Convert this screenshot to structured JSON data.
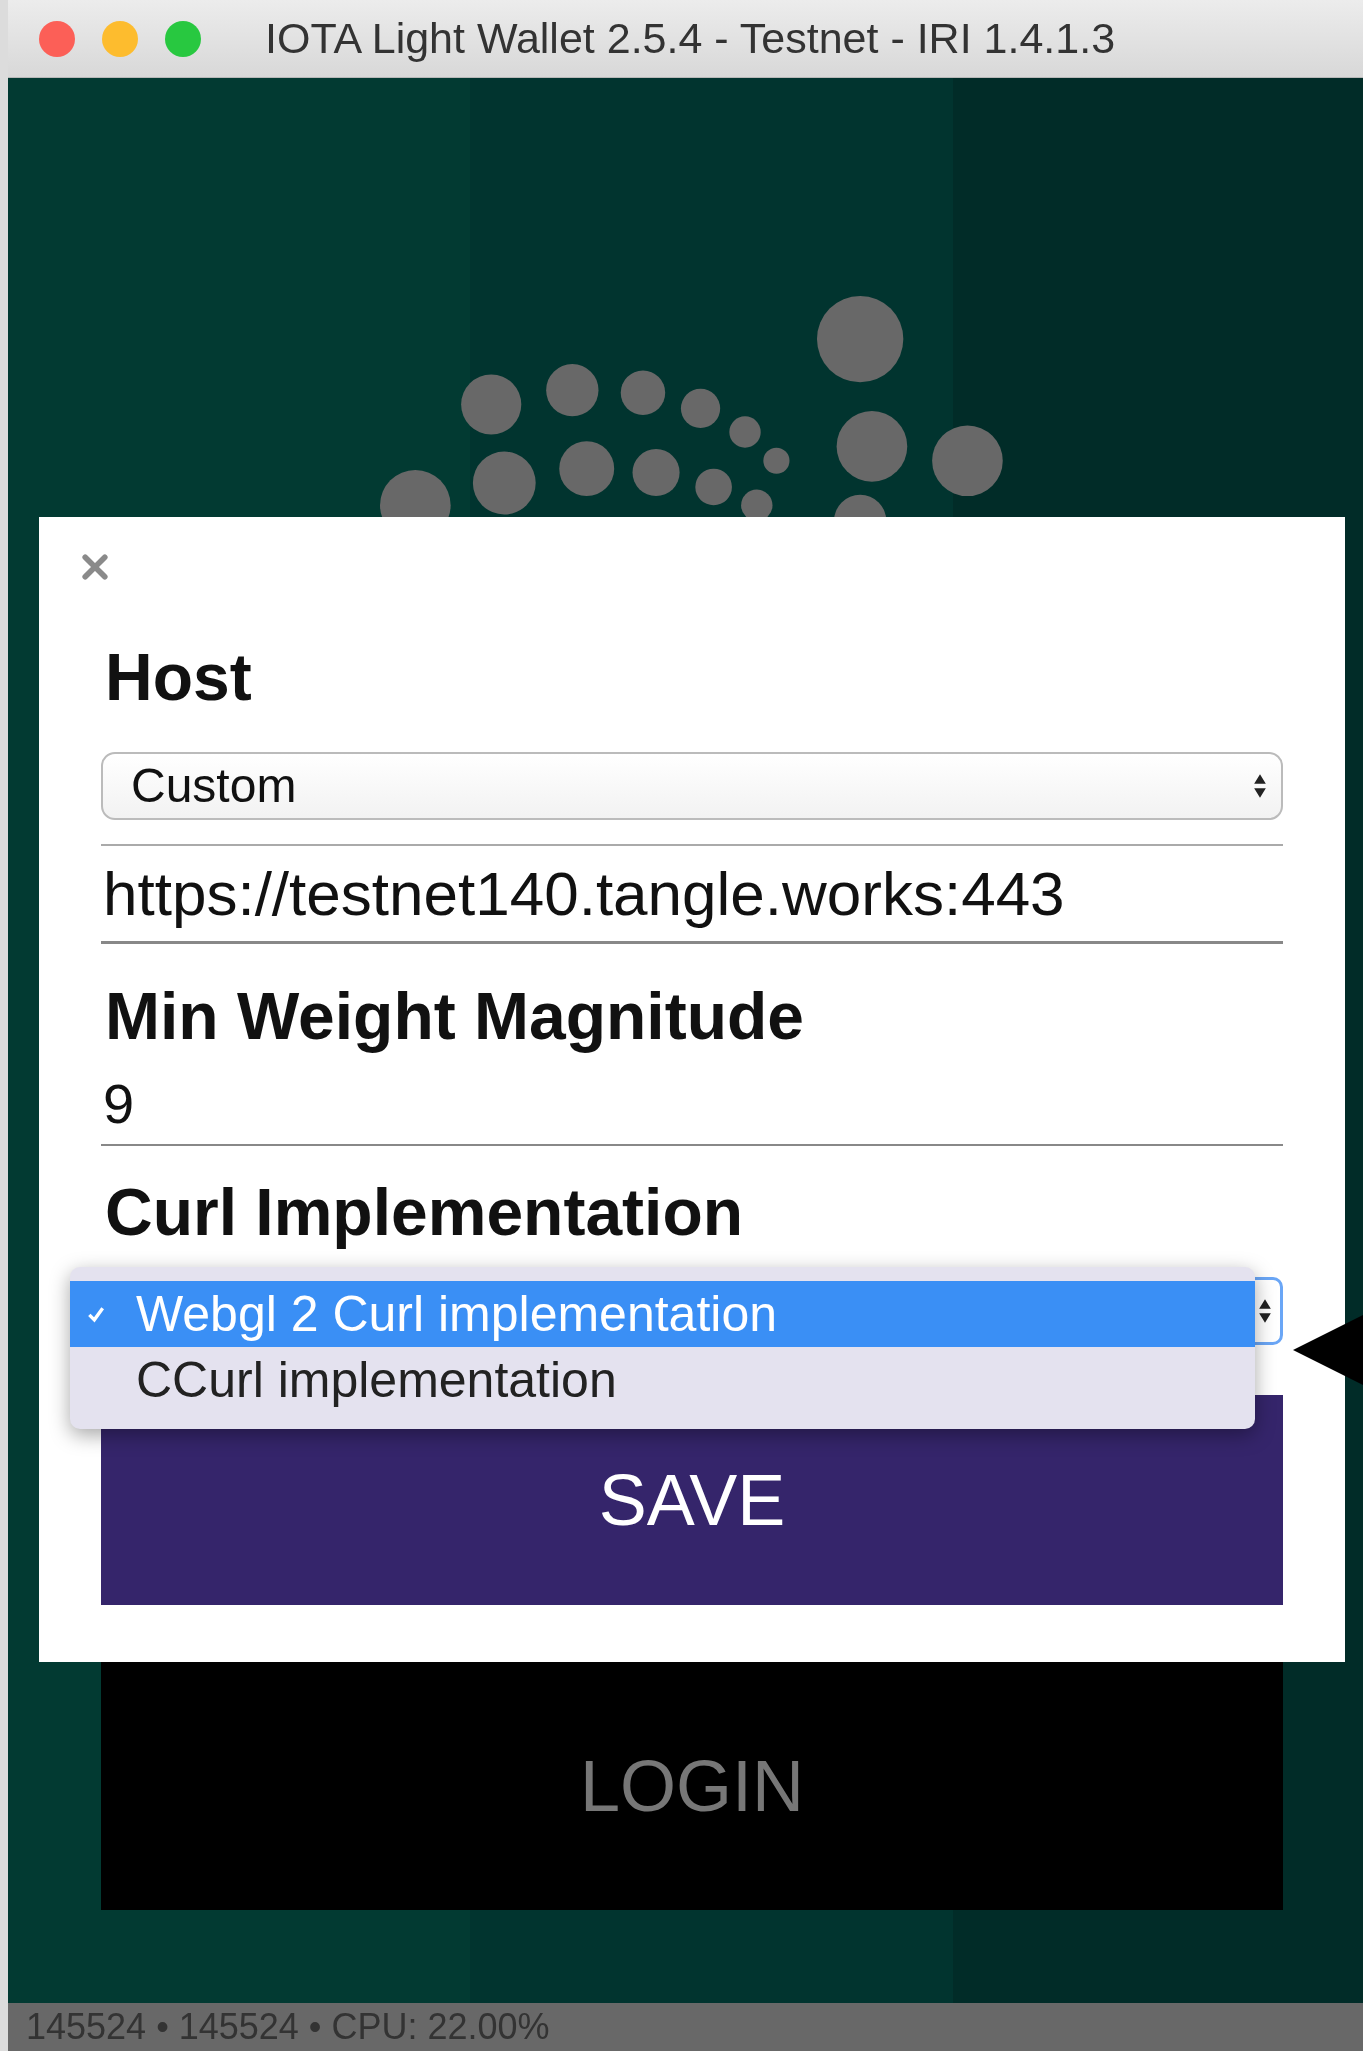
{
  "window": {
    "title": "IOTA Light Wallet 2.5.4 - Testnet - IRI 1.4.1.3"
  },
  "modal": {
    "host_label": "Host",
    "host_select": {
      "value": "Custom"
    },
    "host_url": {
      "value": "https://testnet140.tangle.works:443"
    },
    "mwm_label": "Min Weight Magnitude",
    "mwm": {
      "value": "9"
    },
    "curl_label": "Curl Implementation",
    "curl_options": [
      {
        "label": "Webgl 2 Curl implementation",
        "selected": true
      },
      {
        "label": "CCurl implementation",
        "selected": false
      }
    ],
    "save_button": "SAVE"
  },
  "login_button": "LOGIN",
  "status_bar": "145524 • 145524 • CPU: 22.00%"
}
